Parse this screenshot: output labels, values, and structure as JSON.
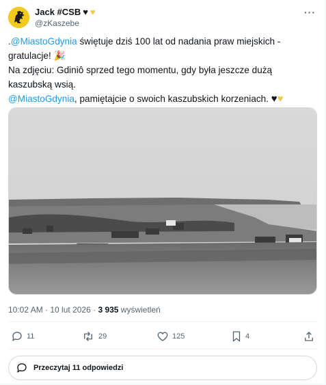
{
  "tweet": {
    "author": {
      "display_name": "Jack #CSB",
      "hearts": [
        "♥",
        "♥"
      ],
      "handle": "@zKaszebe"
    },
    "more_label": "···",
    "text": {
      "line1_prefix": ".",
      "line1_mention": "@MiastoGdynia",
      "line1_rest": " świętuje dziś 100 lat od nadania praw miejskich - gratulacje! ",
      "line1_emoji": "🎉",
      "line2": "Na zdjęciu: Gdiniô sprzed tego momentu, gdy była jeszcze dużą kaszubską wsią.",
      "line3_mention": "@MiastoGdynia",
      "line3_rest": ", pamiętajcie o swoich kaszubskich korzeniach. ",
      "line3_hearts": [
        "♥",
        "♥"
      ]
    },
    "meta": {
      "time": "10:02 AM",
      "sep1": " · ",
      "date": "10 lut 2026",
      "sep2": " · ",
      "views_count": "3 935",
      "views_label": " wyświetleń"
    },
    "actions": {
      "replies": "11",
      "reposts": "29",
      "likes": "125",
      "bookmarks": "4"
    },
    "read_replies_label": "Przeczytaj 11 odpowiedzi"
  },
  "colors": {
    "accent": "#1d9bf0",
    "text": "#0f1419",
    "secondary": "#536471",
    "border": "#cfd9de",
    "heart_black": "#14171a",
    "heart_yellow": "#f5c84c",
    "avatar_bg": "#f4c91d"
  }
}
